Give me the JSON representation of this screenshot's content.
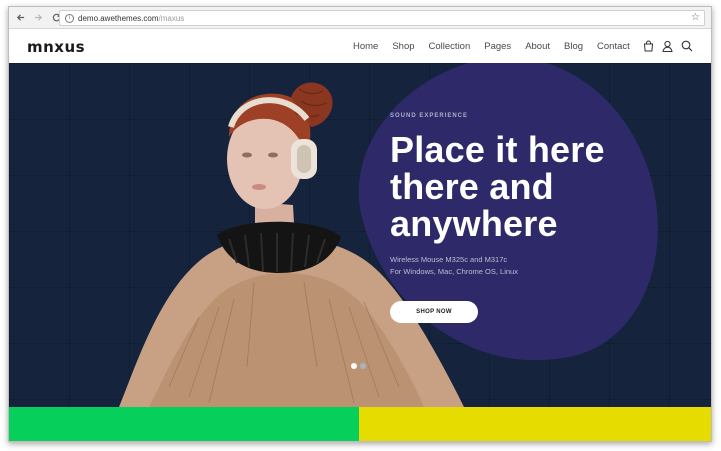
{
  "browser": {
    "back_icon": "arrow-left-icon",
    "forward_icon": "arrow-right-icon",
    "reload_icon": "reload-icon",
    "url_host": "demo.awethemes.com",
    "url_path": "/maxus",
    "bookmark_icon": "star-icon"
  },
  "site": {
    "logo": "mnxus",
    "menu": [
      "Home",
      "Shop",
      "Collection",
      "Pages",
      "About",
      "Blog",
      "Contact"
    ],
    "icons": [
      "bag-icon",
      "user-icon",
      "search-icon"
    ]
  },
  "hero": {
    "eyebrow": "SOUND EXPERIENCE",
    "headline_1": "Place it here",
    "headline_2": "there and",
    "headline_3": "anywhere",
    "sub_1": "Wireless Mouse M325c and M317c",
    "sub_2": "For Windows, Mac, Chrome OS, Linux",
    "cta": "SHOP NOW",
    "slides": 2,
    "active_slide": 1
  },
  "colors": {
    "hero_bg": "#15233d",
    "blob": "#2e2a6a",
    "band_green": "#06d05b",
    "band_yellow": "#e6dc00"
  }
}
